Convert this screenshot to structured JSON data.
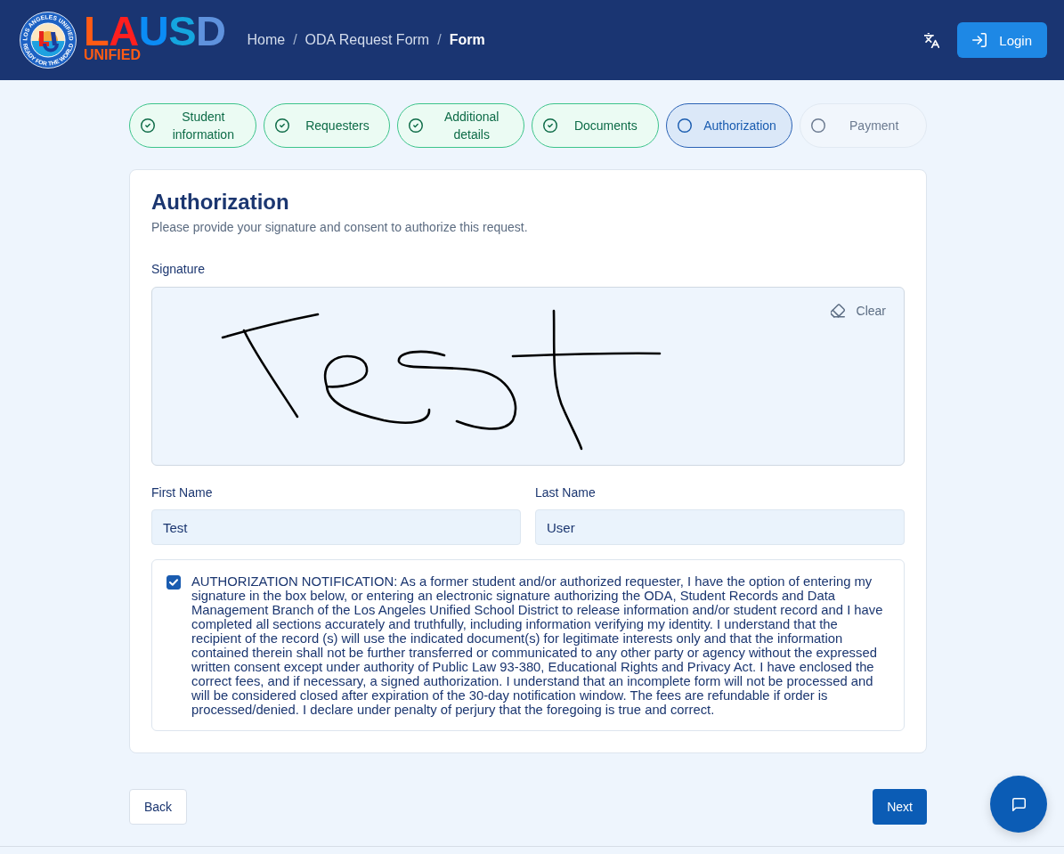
{
  "header": {
    "logo": {
      "emblem_top_text": "LOS ANGELES UNIFIED",
      "emblem_bottom_text": "READY FOR THE WORLD",
      "wordmark": [
        {
          "text": "L",
          "color": "#ff5b14"
        },
        {
          "text": "A",
          "color": "#ff1f1f"
        },
        {
          "text": "U",
          "color": "#0b8cf5"
        },
        {
          "text": "S",
          "color": "#15a6df"
        },
        {
          "text": "D",
          "color": "#5f92dd"
        }
      ],
      "subtitle": "UNIFIED"
    },
    "breadcrumb": [
      {
        "label": "Home",
        "current": false
      },
      {
        "label": "ODA Request Form",
        "separator": "/",
        "current": false
      },
      {
        "label": "Form",
        "separator": "/",
        "current": true
      }
    ],
    "login_button": {
      "label": "Login"
    }
  },
  "steps": [
    {
      "label": "Student information",
      "completed": true,
      "selected": false
    },
    {
      "label": "Requesters",
      "completed": true,
      "selected": false
    },
    {
      "label": "Additional details",
      "completed": true,
      "selected": false
    },
    {
      "label": "Documents",
      "completed": true,
      "selected": false
    },
    {
      "label": "Authorization",
      "completed": false,
      "selected": true
    },
    {
      "label": "Payment",
      "completed": false,
      "selected": false
    }
  ],
  "form": {
    "title": "Authorization",
    "subtitle": "Please provide your signature and consent to authorize this request.",
    "signature": {
      "label": "Signature",
      "clear_button": "Clear"
    },
    "fields": [
      {
        "label": "First Name",
        "value": "Test"
      },
      {
        "label": "Last Name",
        "value": "User"
      }
    ],
    "consent": {
      "checked": true,
      "text": "AUTHORIZATION NOTIFICATION: As a former student and/or authorized requester, I have the option of entering my signature in the box below, or entering an electronic signature authorizing the ODA, Student Records and Data Management Branch of the Los Angeles Unified School District to release information and/or student record and I have completed all sections accurately and truthfully, including information verifying my identity. I understand that the recipient of the record (s) will use the indicated document(s) for legitimate interests only and that the information contained therein shall not be further transferred or communicated to any other party or agency without the expressed written consent except under authority of Public Law 93-380, Educational Rights and Privacy Act. I have enclosed the correct fees, and if necessary, a signed authorization. I understand that an incomplete form will not be processed and will be considered closed after expiration of the 30-day notification window. The fees are refundable if order is processed/denied. I declare under penalty of perjury that the foregoing is true and correct."
    }
  },
  "nav": {
    "back": "Back",
    "next": "Next"
  }
}
